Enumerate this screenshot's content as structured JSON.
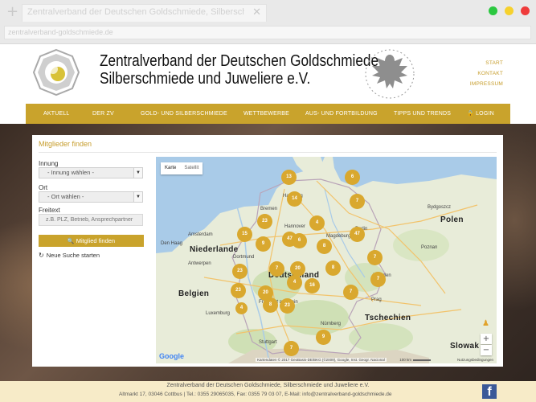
{
  "browser": {
    "tab_title": "Zentralverband der Deutschen Goldschmiede, Silberschmiede…",
    "tab_close": "✕",
    "new_tab": "+",
    "url": "zentralverband-goldschmiede.de"
  },
  "header": {
    "title_line1": "Zentralverband der Deutschen Goldschmiede,",
    "title_line2": "Silberschmiede und Juweliere e.V.",
    "meta_nav": [
      "START",
      "KONTAKT",
      "IMPRESSUM"
    ]
  },
  "nav": {
    "items": [
      "AKTUELL",
      "DER ZV",
      "GOLD- UND SILBERSCHMIEDE",
      "WETTBEWERBE",
      "AUS- UND FORTBILDUNG",
      "TIPPS UND TRENDS",
      "LOGIN"
    ]
  },
  "search": {
    "title": "Mitglieder finden",
    "innung_label": "Innung",
    "innung_value": "- Innung wählen -",
    "ort_label": "Ort",
    "ort_value": "- Ort wählen -",
    "freitext_label": "Freitext",
    "freitext_placeholder": "z.B. PLZ, Betrieb, Ansprechpartner",
    "search_button": "Mitglied finden",
    "reset_link": "Neue Suche starten"
  },
  "map": {
    "tabs": [
      "Karte",
      "Satellit"
    ],
    "countries": [
      "Niederlande",
      "Deutschland",
      "Belgien",
      "Polen",
      "Tschechien",
      "Slowak"
    ],
    "cities": [
      "Hamburg",
      "Bremen",
      "Berlin",
      "Hannover",
      "Magdeburg",
      "Dortmund",
      "Frankfurt am Main",
      "Stuttgart",
      "Bydgoszcz",
      "Poznan",
      "Den Haag",
      "Amsterdam",
      "Antwerpen",
      "Luxemburg",
      "Dresden",
      "Prag",
      "Nürnberg"
    ],
    "clusters": [
      "13",
      "6",
      "14",
      "7",
      "23",
      "4",
      "15",
      "47",
      "9",
      "6",
      "47",
      "8",
      "7",
      "7",
      "20",
      "23",
      "8",
      "4",
      "16",
      "7",
      "23",
      "20",
      "7",
      "8",
      "23",
      "4",
      "7",
      "9"
    ],
    "zoom_in": "+",
    "zoom_out": "−",
    "attribution": "Kartendaten © 2017 GeoBasis-DE/BKG (©2009), Google, Inst. Geogr. Nacional",
    "scale": "100 km",
    "terms": "Nutzungsbedingungen",
    "google": "Google"
  },
  "footer": {
    "line1": "Zentralverband der Deutschen Goldschmiede, Silberschmiede und Juweliere e.V.",
    "line2": "Altmarkt 17, 03046 Cottbus | Tel.: 0355 29065035, Fax: 0355 79 03 07, E-Mail: info@zentralverband-goldschmiede.de",
    "facebook": "f"
  },
  "colors": {
    "gold": "#c9a32c",
    "cluster": "#d9a82f",
    "footer_bg": "#f7ebc8"
  }
}
